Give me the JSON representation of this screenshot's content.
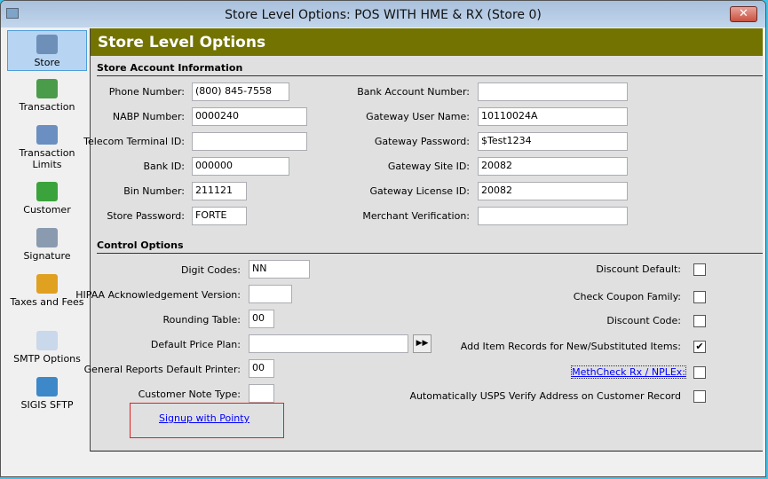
{
  "window": {
    "title": "Store Level Options: POS WITH HME & RX (Store 0)",
    "close_label": "✕"
  },
  "sidebar": {
    "items": [
      {
        "label": "Store",
        "icon": "computer-icon",
        "color": "#6d8fb8",
        "selected": true
      },
      {
        "label": "Transaction",
        "icon": "cash-register-icon",
        "color": "#4a9c4a"
      },
      {
        "label": "Transaction Limits",
        "icon": "transaction-limits-icon",
        "color": "#6a8fc0"
      },
      {
        "label": "Customer",
        "icon": "customer-icon",
        "color": "#3ba33b"
      },
      {
        "label": "Signature",
        "icon": "signature-icon",
        "color": "#8a9bb0"
      },
      {
        "label": "Taxes and Fees",
        "icon": "dollar-coin-icon",
        "color": "#e0a020"
      },
      {
        "label": "SMTP Options",
        "icon": "envelope-icon",
        "color": "#c9d8ea"
      },
      {
        "label": "SIGIS SFTP",
        "icon": "network-icon",
        "color": "#3c88c8"
      }
    ]
  },
  "header": {
    "title": "Store Level Options"
  },
  "account": {
    "title": "Store Account Information",
    "left": [
      {
        "label": "Phone Number:",
        "value": "(800) 845-7558"
      },
      {
        "label": "NABP Number:",
        "value": "0000240"
      },
      {
        "label": "Telecom Terminal ID:",
        "value": ""
      },
      {
        "label": "Bank ID:",
        "value": "000000"
      },
      {
        "label": "Bin Number:",
        "value": "211121"
      },
      {
        "label": "Store Password:",
        "value": "FORTE"
      }
    ],
    "right": [
      {
        "label": "Bank Account Number:",
        "value": ""
      },
      {
        "label": "Gateway User Name:",
        "value": "10110024A"
      },
      {
        "label": "Gateway Password:",
        "value": "$Test1234"
      },
      {
        "label": "Gateway Site ID:",
        "value": "20082"
      },
      {
        "label": "Gateway License ID:",
        "value": "20082"
      },
      {
        "label": "Merchant Verification:",
        "value": ""
      }
    ]
  },
  "control": {
    "title": "Control Options",
    "left": [
      {
        "label": "Digit Codes:",
        "value": "NN"
      },
      {
        "label": "HIPAA Acknowledgement Version:",
        "value": ""
      },
      {
        "label": "Rounding Table:",
        "value": "00"
      },
      {
        "label": "Default Price Plan:",
        "value": ""
      },
      {
        "label": "General Reports Default Printer:",
        "value": "00"
      },
      {
        "label": "Customer Note Type:",
        "value": ""
      }
    ],
    "price_plan_button": "▶▶",
    "right": [
      {
        "label": "Discount Default:",
        "checked": false
      },
      {
        "label": "Check Coupon Family:",
        "checked": false
      },
      {
        "label": "Discount Code:",
        "checked": false
      },
      {
        "label": "Add Item Records for New/Substituted Items:",
        "checked": true
      },
      {
        "label": "MethCheck Rx / NPLEx:",
        "checked": false,
        "link": true
      },
      {
        "label": "Automatically USPS Verify Address on Customer Record",
        "checked": false
      }
    ],
    "signup_link": "Signup with Pointy"
  }
}
